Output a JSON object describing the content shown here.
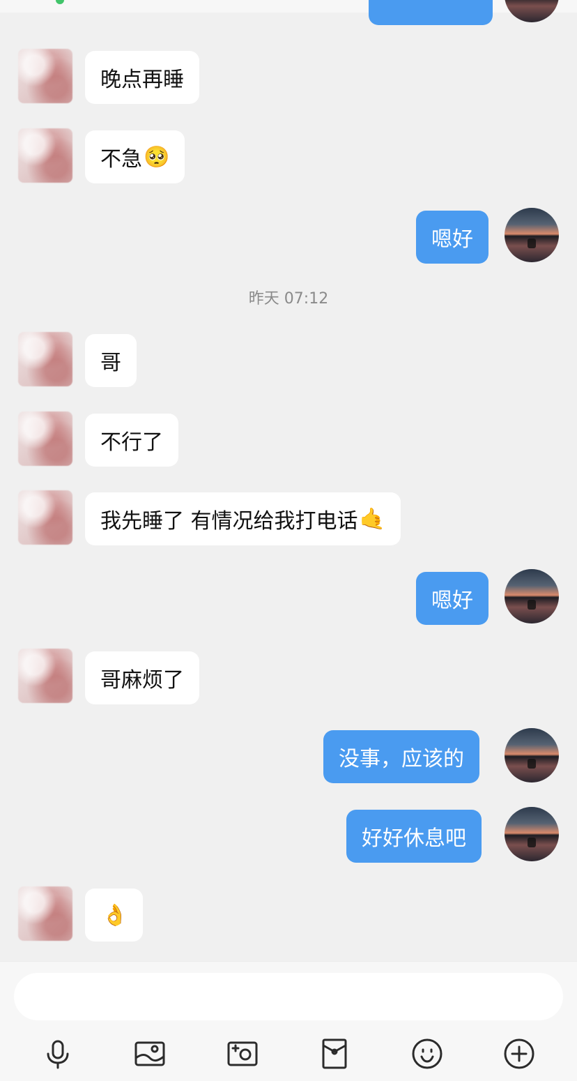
{
  "chat": {
    "timestamp": "昨天 07:12",
    "messages": [
      {
        "side": "in",
        "text": "晚点再睡"
      },
      {
        "side": "in",
        "text": "不急",
        "emoji": "🥺"
      },
      {
        "side": "out",
        "text": "嗯好"
      },
      {
        "side": "in",
        "text": "哥"
      },
      {
        "side": "in",
        "text": "不行了"
      },
      {
        "side": "in",
        "text": "我先睡了 有情况给我打电话",
        "emoji": "🤙"
      },
      {
        "side": "out",
        "text": "嗯好"
      },
      {
        "side": "in",
        "text": "哥麻烦了"
      },
      {
        "side": "out",
        "text": "没事，应该的"
      },
      {
        "side": "out",
        "text": "好好休息吧"
      },
      {
        "side": "in",
        "text": "",
        "emoji": "👌"
      }
    ]
  },
  "composer": {
    "input_value": "",
    "input_placeholder": "",
    "tools": [
      "mic-icon",
      "image-icon",
      "camera-icon",
      "red-packet-icon",
      "emoji-icon",
      "plus-icon"
    ]
  }
}
